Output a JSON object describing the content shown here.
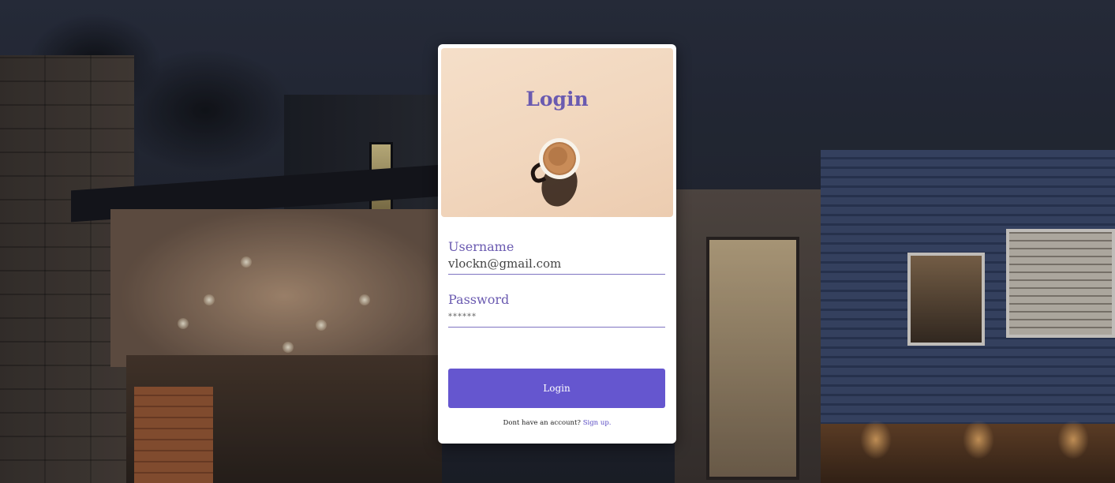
{
  "login_card": {
    "hero_title": "Login",
    "username": {
      "label": "Username",
      "value": "vlockn@gmail.com"
    },
    "password": {
      "label": "Password",
      "value": "******"
    },
    "login_button_label": "Login",
    "signup_prompt": "Dont have an account?",
    "signup_link_label": "Sign up."
  },
  "icons": {
    "hero_image": "coffee-cup-image"
  },
  "colors": {
    "accent": "#6556cf",
    "label_text": "#6a5ab0",
    "hero_background": "#f3dac4",
    "card_background": "#ffffff"
  }
}
